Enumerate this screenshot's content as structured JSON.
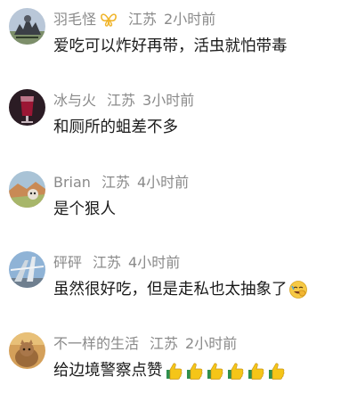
{
  "comments": [
    {
      "username": "羽毛怪",
      "has_badge": true,
      "location": "江苏",
      "time": "2小时前",
      "text": "爱吃可以炸好再带，活虫就怕带毒",
      "emojis": []
    },
    {
      "username": "冰与火",
      "has_badge": false,
      "location": "江苏",
      "time": "3小时前",
      "text": "和厕所的蛆差不多",
      "emojis": []
    },
    {
      "username": "Brian",
      "has_badge": false,
      "location": "江苏",
      "time": "4小时前",
      "text": "是个狠人",
      "emojis": []
    },
    {
      "username": "砰砰",
      "has_badge": false,
      "location": "江苏",
      "time": "4小时前",
      "text": "虽然很好吃，但是走私也太抽象了",
      "emojis": [
        "facepalm-laugh"
      ]
    },
    {
      "username": "不一样的生活",
      "has_badge": false,
      "location": "江苏",
      "time": "2小时前",
      "text": "给边境警察点赞",
      "emojis": [
        "thumbs-up",
        "thumbs-up",
        "thumbs-up",
        "thumbs-up",
        "thumbs-up",
        "thumbs-up"
      ]
    }
  ],
  "colors": {
    "meta": "#8a8a8a",
    "text": "#1a1a1a",
    "badge": "#f0b429",
    "thumb": "#f5c518"
  }
}
